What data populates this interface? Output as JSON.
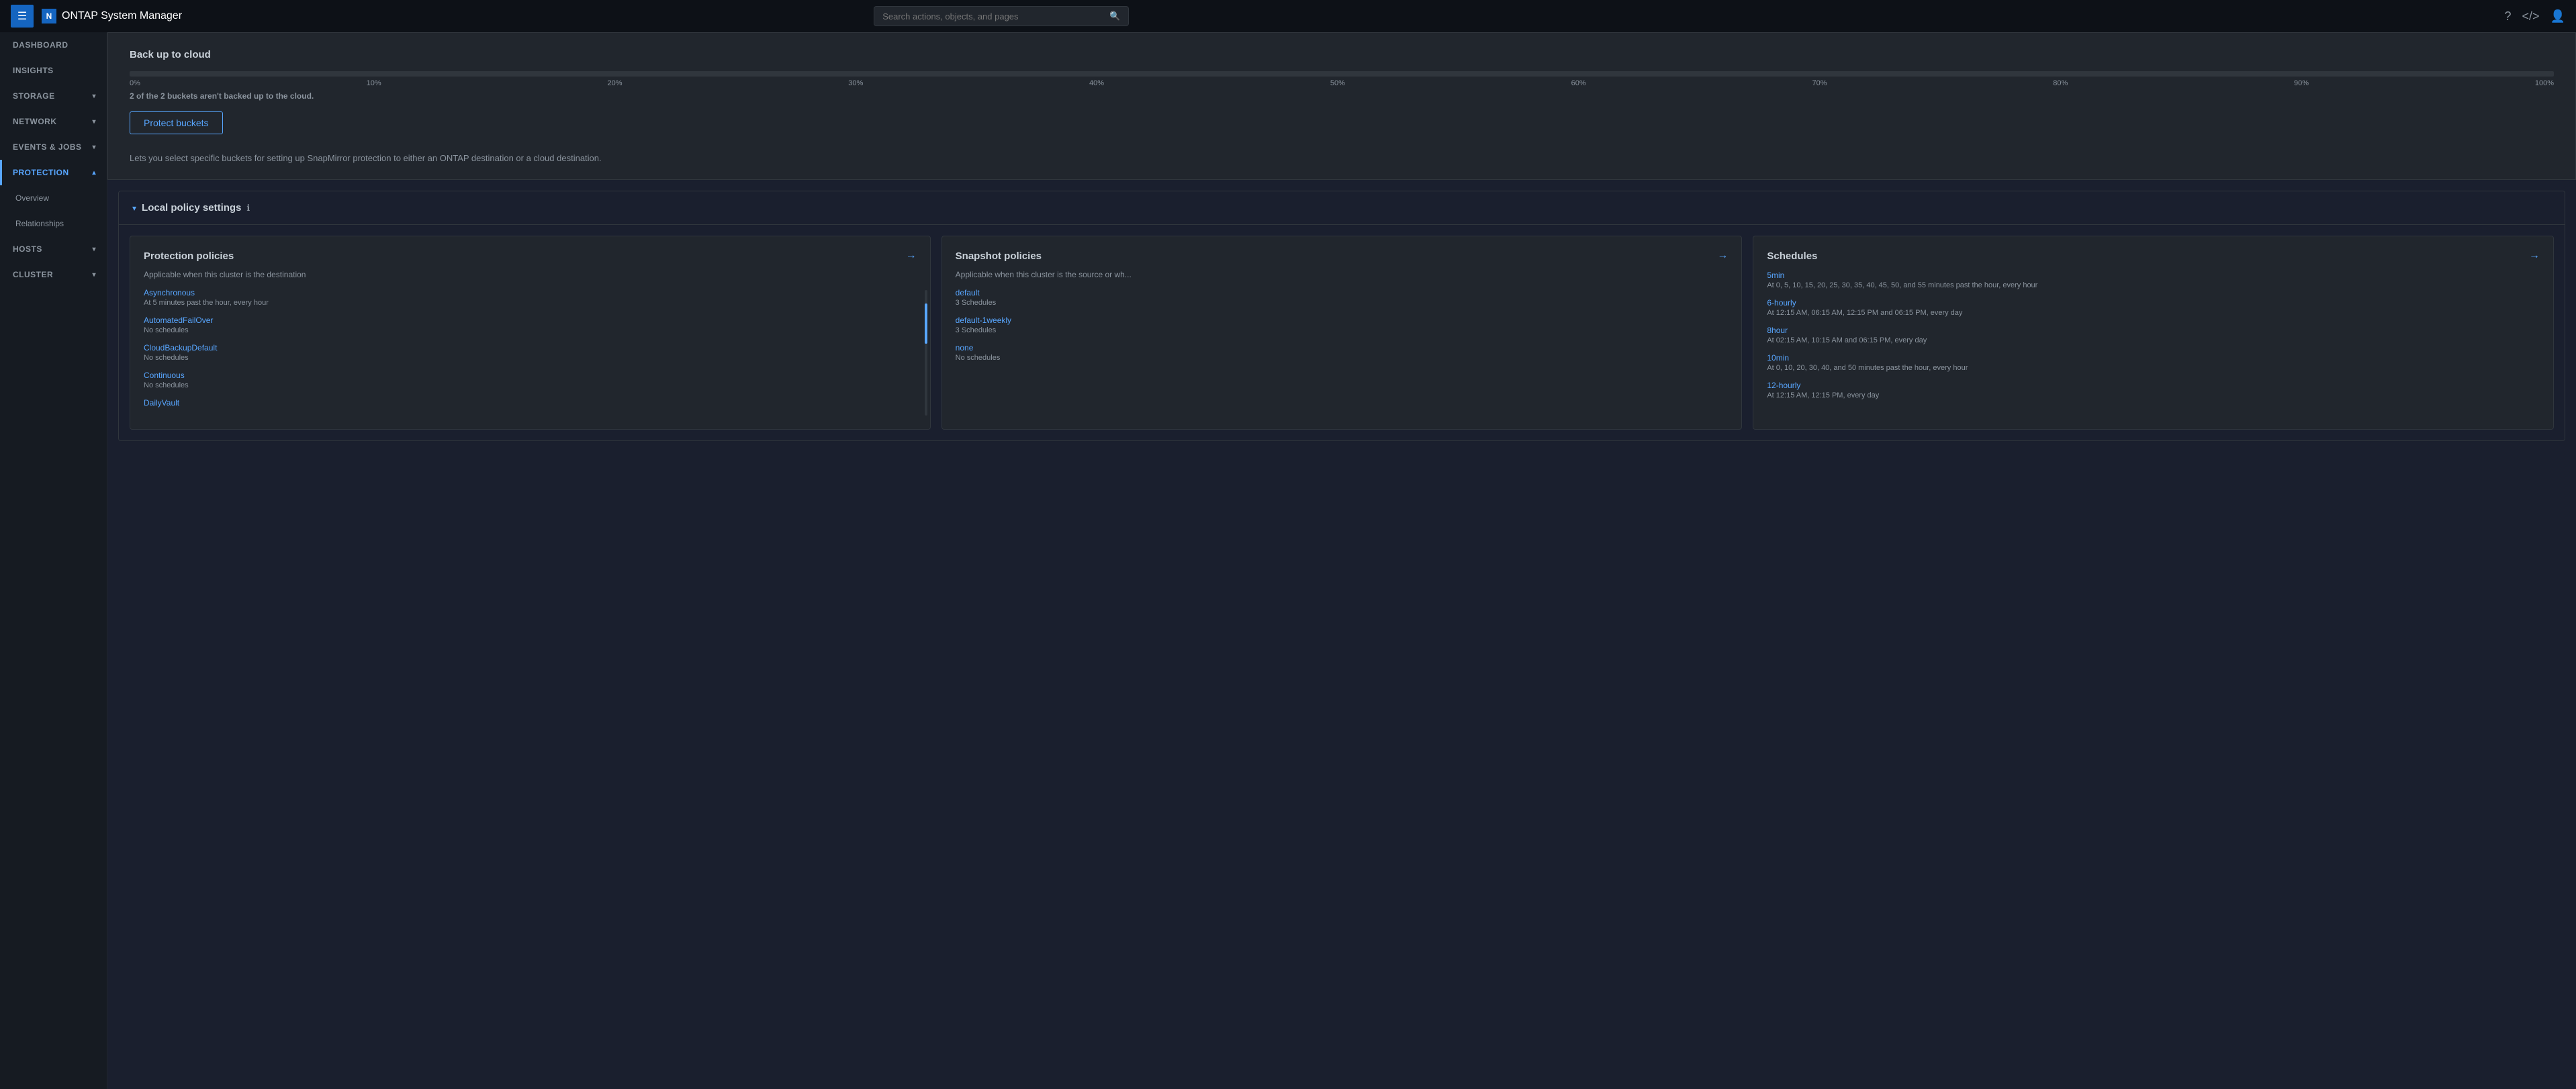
{
  "topbar": {
    "menu_label": "☰",
    "logo_text": "ONTAP System Manager",
    "search_placeholder": "Search actions, objects, and pages",
    "help_icon": "?",
    "code_icon": "</>",
    "user_icon": "👤"
  },
  "sidebar": {
    "items": [
      {
        "id": "dashboard",
        "label": "DASHBOARD",
        "has_chevron": false,
        "active": false
      },
      {
        "id": "insights",
        "label": "INSIGHTS",
        "has_chevron": false,
        "active": false
      },
      {
        "id": "storage",
        "label": "STORAGE",
        "has_chevron": true,
        "active": false
      },
      {
        "id": "network",
        "label": "NETWORK",
        "has_chevron": true,
        "active": false
      },
      {
        "id": "events-jobs",
        "label": "EVENTS & JOBS",
        "has_chevron": true,
        "active": false
      },
      {
        "id": "protection",
        "label": "PROTECTION",
        "has_chevron": true,
        "active": true
      },
      {
        "id": "overview",
        "label": "Overview",
        "is_sub": true,
        "active": false
      },
      {
        "id": "relationships",
        "label": "Relationships",
        "is_sub": true,
        "active": false
      },
      {
        "id": "hosts",
        "label": "HOSTS",
        "has_chevron": true,
        "active": false
      },
      {
        "id": "cluster",
        "label": "CLUSTER",
        "has_chevron": true,
        "active": false
      }
    ]
  },
  "backup_section": {
    "title": "Back up to cloud",
    "progress_fill_pct": 0,
    "progress_labels": [
      "0%",
      "10%",
      "20%",
      "30%",
      "40%",
      "50%",
      "60%",
      "70%",
      "80%",
      "90%",
      "100%"
    ],
    "status_text": "2 of the  2 buckets aren't backed up to the cloud.",
    "protect_btn_label": "Protect buckets",
    "description": "Lets you select specific buckets for setting up SnapMirror protection to either an ONTAP destination or a cloud destination."
  },
  "local_policy": {
    "title": "Local policy settings",
    "section_open": true,
    "cards": [
      {
        "id": "protection-policies",
        "title": "Protection policies",
        "subtitle": "Applicable when this cluster is the destination",
        "items": [
          {
            "name": "Asynchronous",
            "detail": "At 5 minutes past the hour, every hour",
            "is_link": true
          },
          {
            "name": "AutomatedFailOver",
            "detail": "No schedules",
            "is_link": true
          },
          {
            "name": "CloudBackupDefault",
            "detail": "No schedules",
            "is_link": true
          },
          {
            "name": "Continuous",
            "detail": "No schedules",
            "is_link": true
          },
          {
            "name": "DailyVault",
            "detail": "",
            "is_link": true
          }
        ]
      },
      {
        "id": "snapshot-policies",
        "title": "Snapshot policies",
        "subtitle": "Applicable when this cluster is the source or wh...",
        "items": [
          {
            "name": "default",
            "detail": "3 Schedules",
            "is_link": true
          },
          {
            "name": "default-1weekly",
            "detail": "3 Schedules",
            "is_link": true
          },
          {
            "name": "none",
            "detail": "No schedules",
            "is_link": true
          }
        ]
      },
      {
        "id": "schedules",
        "title": "Schedules",
        "subtitle": "",
        "items": [
          {
            "name": "5min",
            "detail": "At 0, 5, 10, 15, 20, 25, 30, 35, 40, 45, 50, and 55 minutes past the hour, every hour",
            "is_link": true
          },
          {
            "name": "6-hourly",
            "detail": "At 12:15 AM, 06:15 AM, 12:15 PM and 06:15 PM, every day",
            "is_link": true
          },
          {
            "name": "8hour",
            "detail": "At 02:15 AM, 10:15 AM and 06:15 PM, every day",
            "is_link": true
          },
          {
            "name": "10min",
            "detail": "At 0, 10, 20, 30, 40, and 50 minutes past the hour, every hour",
            "is_link": true
          },
          {
            "name": "12-hourly",
            "detail": "At 12:15 AM, 12:15 PM, every day",
            "is_link": true
          }
        ]
      }
    ]
  }
}
